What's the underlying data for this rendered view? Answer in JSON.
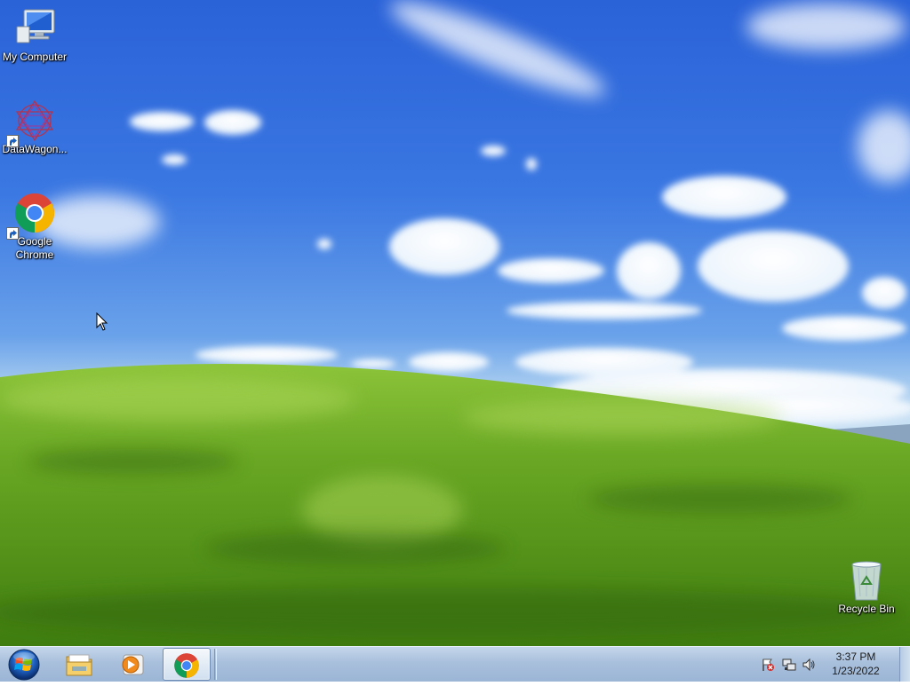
{
  "desktop": {
    "icons": [
      {
        "label": "My Computer",
        "icon": "computer-icon"
      },
      {
        "label": "DataWagon...",
        "icon": "datawagon-icon",
        "shortcut": true
      },
      {
        "label": "Google Chrome",
        "icon": "chrome-icon",
        "shortcut": true
      },
      {
        "label": "Recycle Bin",
        "icon": "recycle-bin-icon"
      }
    ]
  },
  "taskbar": {
    "start": {
      "icon": "windows-start-icon"
    },
    "pinned": [
      {
        "name": "Windows Explorer",
        "icon": "folder-explorer-icon",
        "active": false
      },
      {
        "name": "Windows Media Player",
        "icon": "media-player-icon",
        "active": false
      },
      {
        "name": "Google Chrome",
        "icon": "chrome-icon",
        "active": true
      }
    ],
    "tray": {
      "icons": [
        "action-center-flag-icon",
        "network-icon",
        "volume-icon"
      ],
      "time": "3:37 PM",
      "date": "1/23/2022"
    }
  },
  "colors": {
    "sky_top": "#2a62d8",
    "grass": "#5f9a1e",
    "taskbar": "#a9c0dc",
    "chrome_red": "#db4437",
    "chrome_yellow": "#f4b400",
    "chrome_green": "#0f9d58",
    "chrome_blue": "#4285f4"
  }
}
